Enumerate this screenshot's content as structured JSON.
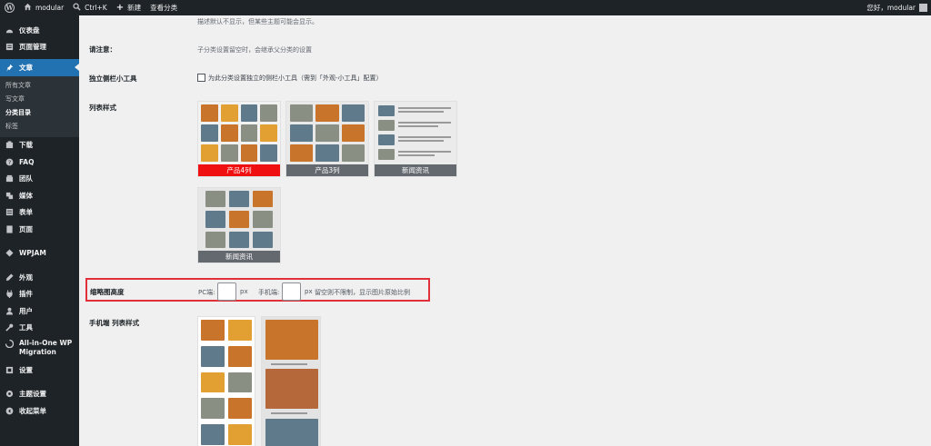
{
  "adminbar": {
    "site_name": "modular",
    "search_label": "Ctrl+K",
    "new_label": "新建",
    "view_category_label": "查看分类",
    "greeting": "您好，modular"
  },
  "sidebar": {
    "items": [
      {
        "label": "仪表盘",
        "icon": "dashboard-icon"
      },
      {
        "label": "页面管理",
        "icon": "pages-icon"
      },
      {
        "label": "文章",
        "icon": "pin-icon"
      },
      {
        "label": "下载",
        "icon": "download-icon"
      },
      {
        "label": "FAQ",
        "icon": "help-icon"
      },
      {
        "label": "团队",
        "icon": "team-icon"
      },
      {
        "label": "媒体",
        "icon": "media-icon"
      },
      {
        "label": "表单",
        "icon": "form-icon"
      },
      {
        "label": "页面",
        "icon": "page-icon"
      },
      {
        "label": "WPJAM",
        "icon": "wpjam-icon"
      },
      {
        "label": "外观",
        "icon": "appearance-icon"
      },
      {
        "label": "插件",
        "icon": "plugins-icon"
      },
      {
        "label": "用户",
        "icon": "users-icon"
      },
      {
        "label": "工具",
        "icon": "tools-icon"
      },
      {
        "label": "All-in-One WP Migration",
        "icon": "migration-icon"
      },
      {
        "label": "设置",
        "icon": "settings-icon"
      },
      {
        "label": "主题设置",
        "icon": "theme-settings-icon"
      },
      {
        "label": "收起菜单",
        "icon": "collapse-icon"
      }
    ],
    "posts_submenu": [
      "所有文章",
      "写文章",
      "分类目录",
      "标签"
    ]
  },
  "form": {
    "top_desc": "描述默认不显示，但某些主题可能会显示。",
    "notice_label": "请注意：",
    "notice_text": "子分类设置留空时，会继承父分类的设置",
    "sidebar_widget_label": "独立侧栏小工具",
    "sidebar_widget_text": "为此分类设置独立的侧栏小工具（需到「外观-小工具」配置）",
    "list_style_label": "列表样式",
    "list_styles": [
      "产品4列",
      "产品3列",
      "新闻资讯",
      "新闻资讯"
    ],
    "thumb_height_label": "缩略图高度",
    "pc_label": "PC端:",
    "px1": "px",
    "mobile_label": "手机端:",
    "px2": "px",
    "thumb_height_hint": "留空则不限制，显示图片原始比例",
    "mobile_list_style_label": "手机端 列表样式"
  },
  "colors": {
    "selected_caption": "#ef1111",
    "highlight_border": "#e2303a",
    "menu_active": "#2271b1"
  }
}
